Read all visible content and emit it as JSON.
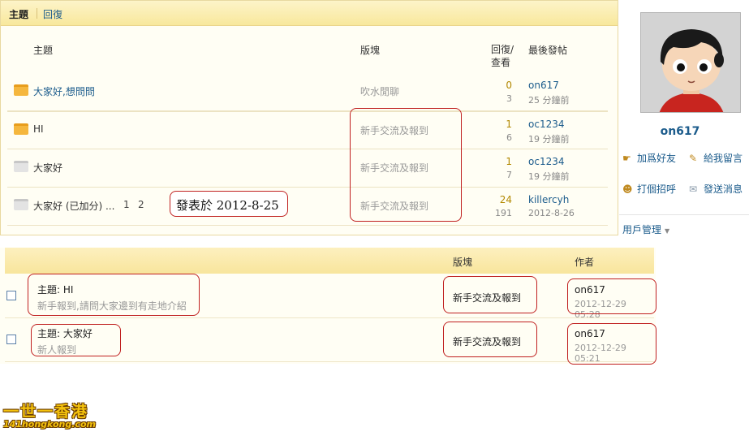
{
  "tabs": {
    "topics": "主題",
    "replies": "回復"
  },
  "forum_list": {
    "headers": {
      "topic": "主題",
      "board": "版塊",
      "replies_views": "回復/查看",
      "last_post": "最後發帖"
    },
    "rows": [
      {
        "title": "大家好,想問問",
        "icon": "folder-new-icon",
        "board": "吹水閒聊",
        "replies": "0",
        "views": "3",
        "last_user": "on617",
        "last_time": "25 分鐘前"
      },
      {
        "title": "HI",
        "icon": "folder-new-icon",
        "board": "新手交流及報到",
        "replies": "1",
        "views": "6",
        "last_user": "oc1234",
        "last_time": "19 分鐘前"
      },
      {
        "title": "大家好",
        "icon": "folder-old-icon",
        "board": "新手交流及報到",
        "replies": "1",
        "views": "7",
        "last_user": "oc1234",
        "last_time": "19 分鐘前"
      },
      {
        "title": "大家好 (已加分) ...",
        "pages": [
          "1",
          "2"
        ],
        "icon": "folder-old-icon",
        "board": "新手交流及報到",
        "replies": "24",
        "views": "191",
        "last_user": "killercyh",
        "last_time": "2012-8-26"
      }
    ],
    "posted_on_note": "發表於 2012-8-25"
  },
  "profile": {
    "username": "on617",
    "actions": {
      "add_friend": "加爲好友",
      "leave_message": "給我留言",
      "greet": "打個招呼",
      "send_message": "發送消息"
    },
    "user_management": "用戶管理"
  },
  "post_table": {
    "headers": {
      "board": "版塊",
      "author": "作者"
    },
    "rows": [
      {
        "subject": "主題:  HI",
        "preview": "新手報到,請問大家邊到有走地介紹",
        "board": "新手交流及報到",
        "author": "on617",
        "time": "2012-12-29 05:28"
      },
      {
        "subject": "主題:  大家好",
        "preview": "新人報到",
        "board": "新手交流及報到",
        "author": "on617",
        "time": "2012-12-29 05:21"
      }
    ]
  },
  "watermark": {
    "text": "一世一香港",
    "url": "141hongkong.com"
  },
  "colors": {
    "link": "#1c5c8c",
    "header_bg": "#f8e89c",
    "annotation": "#c02020",
    "reply_count": "#b28800"
  }
}
